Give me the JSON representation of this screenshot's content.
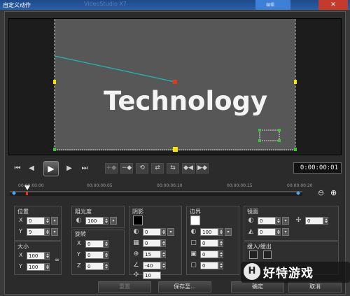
{
  "window": {
    "title": "自定义动作",
    "ghost_title": "VideoStudio X7",
    "close_glyph": "✕",
    "top_tab_label": "编辑"
  },
  "preview": {
    "text": "Technology"
  },
  "transport": {
    "timecode": "0:00:00:01",
    "buttons": [
      "first-frame",
      "prev-frame",
      "play",
      "next-frame",
      "last-frame"
    ],
    "keyframe_buttons": [
      "add-keyframe",
      "remove-keyframe",
      "reverse-keyframe",
      "move-left",
      "move-right",
      "goto-prev-keyframe",
      "goto-next-keyframe"
    ]
  },
  "timeline": {
    "ticks": [
      "00:00:00:00",
      "00:00:00:05",
      "00:00:00:10",
      "00:00:00:15",
      "00:00:00:20"
    ]
  },
  "position": {
    "title": "位置",
    "x": "0",
    "y": "9"
  },
  "size": {
    "title": "大小",
    "x": "100",
    "y": "100"
  },
  "opacity": {
    "title": "阻光度",
    "value": "100"
  },
  "rotation": {
    "title": "旋转",
    "x": "0",
    "y": "0",
    "z": "0"
  },
  "shadow": {
    "title": "阴影",
    "values": [
      "0",
      "0",
      "15",
      "-40",
      "10"
    ]
  },
  "border": {
    "title": "边界",
    "values": [
      "100",
      "0",
      "0",
      "0"
    ]
  },
  "mirror": {
    "title": "镜面",
    "values": [
      "0",
      "0",
      "0"
    ],
    "extra": "0"
  },
  "fade": {
    "title": "缓入/缓出"
  },
  "buttons": {
    "reset": "重置",
    "save_as": "保存至...",
    "ok": "确定",
    "cancel": "取消"
  },
  "watermark": {
    "text": "好特游戏",
    "logo": "H"
  },
  "colors": {
    "accent": "#2a5fa8",
    "path_line": "#1fb8b8",
    "keyframe_red": "#e03a1a",
    "handle_yellow": "#f5e400"
  }
}
